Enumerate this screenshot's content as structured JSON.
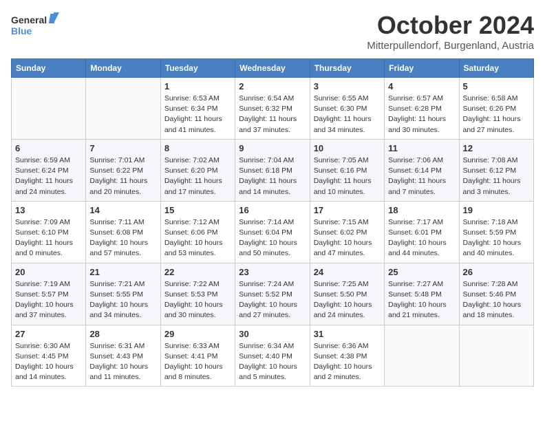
{
  "logo": {
    "line1": "General",
    "line2": "Blue"
  },
  "title": "October 2024",
  "subtitle": "Mitterpullendorf, Burgenland, Austria",
  "days_of_week": [
    "Sunday",
    "Monday",
    "Tuesday",
    "Wednesday",
    "Thursday",
    "Friday",
    "Saturday"
  ],
  "weeks": [
    [
      {
        "day": "",
        "info": ""
      },
      {
        "day": "",
        "info": ""
      },
      {
        "day": "1",
        "info": "Sunrise: 6:53 AM\nSunset: 6:34 PM\nDaylight: 11 hours and 41 minutes."
      },
      {
        "day": "2",
        "info": "Sunrise: 6:54 AM\nSunset: 6:32 PM\nDaylight: 11 hours and 37 minutes."
      },
      {
        "day": "3",
        "info": "Sunrise: 6:55 AM\nSunset: 6:30 PM\nDaylight: 11 hours and 34 minutes."
      },
      {
        "day": "4",
        "info": "Sunrise: 6:57 AM\nSunset: 6:28 PM\nDaylight: 11 hours and 30 minutes."
      },
      {
        "day": "5",
        "info": "Sunrise: 6:58 AM\nSunset: 6:26 PM\nDaylight: 11 hours and 27 minutes."
      }
    ],
    [
      {
        "day": "6",
        "info": "Sunrise: 6:59 AM\nSunset: 6:24 PM\nDaylight: 11 hours and 24 minutes."
      },
      {
        "day": "7",
        "info": "Sunrise: 7:01 AM\nSunset: 6:22 PM\nDaylight: 11 hours and 20 minutes."
      },
      {
        "day": "8",
        "info": "Sunrise: 7:02 AM\nSunset: 6:20 PM\nDaylight: 11 hours and 17 minutes."
      },
      {
        "day": "9",
        "info": "Sunrise: 7:04 AM\nSunset: 6:18 PM\nDaylight: 11 hours and 14 minutes."
      },
      {
        "day": "10",
        "info": "Sunrise: 7:05 AM\nSunset: 6:16 PM\nDaylight: 11 hours and 10 minutes."
      },
      {
        "day": "11",
        "info": "Sunrise: 7:06 AM\nSunset: 6:14 PM\nDaylight: 11 hours and 7 minutes."
      },
      {
        "day": "12",
        "info": "Sunrise: 7:08 AM\nSunset: 6:12 PM\nDaylight: 11 hours and 3 minutes."
      }
    ],
    [
      {
        "day": "13",
        "info": "Sunrise: 7:09 AM\nSunset: 6:10 PM\nDaylight: 11 hours and 0 minutes."
      },
      {
        "day": "14",
        "info": "Sunrise: 7:11 AM\nSunset: 6:08 PM\nDaylight: 10 hours and 57 minutes."
      },
      {
        "day": "15",
        "info": "Sunrise: 7:12 AM\nSunset: 6:06 PM\nDaylight: 10 hours and 53 minutes."
      },
      {
        "day": "16",
        "info": "Sunrise: 7:14 AM\nSunset: 6:04 PM\nDaylight: 10 hours and 50 minutes."
      },
      {
        "day": "17",
        "info": "Sunrise: 7:15 AM\nSunset: 6:02 PM\nDaylight: 10 hours and 47 minutes."
      },
      {
        "day": "18",
        "info": "Sunrise: 7:17 AM\nSunset: 6:01 PM\nDaylight: 10 hours and 44 minutes."
      },
      {
        "day": "19",
        "info": "Sunrise: 7:18 AM\nSunset: 5:59 PM\nDaylight: 10 hours and 40 minutes."
      }
    ],
    [
      {
        "day": "20",
        "info": "Sunrise: 7:19 AM\nSunset: 5:57 PM\nDaylight: 10 hours and 37 minutes."
      },
      {
        "day": "21",
        "info": "Sunrise: 7:21 AM\nSunset: 5:55 PM\nDaylight: 10 hours and 34 minutes."
      },
      {
        "day": "22",
        "info": "Sunrise: 7:22 AM\nSunset: 5:53 PM\nDaylight: 10 hours and 30 minutes."
      },
      {
        "day": "23",
        "info": "Sunrise: 7:24 AM\nSunset: 5:52 PM\nDaylight: 10 hours and 27 minutes."
      },
      {
        "day": "24",
        "info": "Sunrise: 7:25 AM\nSunset: 5:50 PM\nDaylight: 10 hours and 24 minutes."
      },
      {
        "day": "25",
        "info": "Sunrise: 7:27 AM\nSunset: 5:48 PM\nDaylight: 10 hours and 21 minutes."
      },
      {
        "day": "26",
        "info": "Sunrise: 7:28 AM\nSunset: 5:46 PM\nDaylight: 10 hours and 18 minutes."
      }
    ],
    [
      {
        "day": "27",
        "info": "Sunrise: 6:30 AM\nSunset: 4:45 PM\nDaylight: 10 hours and 14 minutes."
      },
      {
        "day": "28",
        "info": "Sunrise: 6:31 AM\nSunset: 4:43 PM\nDaylight: 10 hours and 11 minutes."
      },
      {
        "day": "29",
        "info": "Sunrise: 6:33 AM\nSunset: 4:41 PM\nDaylight: 10 hours and 8 minutes."
      },
      {
        "day": "30",
        "info": "Sunrise: 6:34 AM\nSunset: 4:40 PM\nDaylight: 10 hours and 5 minutes."
      },
      {
        "day": "31",
        "info": "Sunrise: 6:36 AM\nSunset: 4:38 PM\nDaylight: 10 hours and 2 minutes."
      },
      {
        "day": "",
        "info": ""
      },
      {
        "day": "",
        "info": ""
      }
    ]
  ]
}
